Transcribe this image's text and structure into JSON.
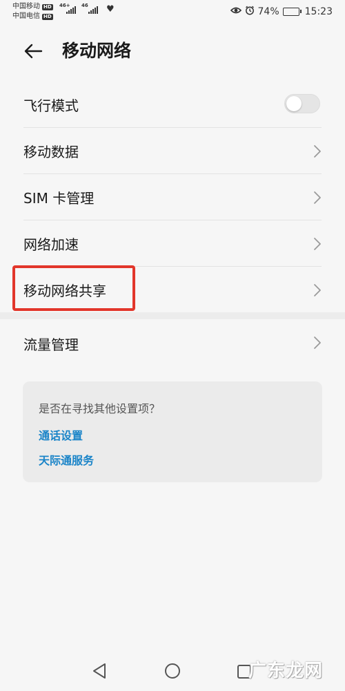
{
  "status_bar": {
    "carrier_1": "中国移动",
    "carrier_2": "中国电信",
    "hd_badge": "HD",
    "net_1": "46+",
    "net_2": "46",
    "battery_percent": "74%",
    "battery_level": 0.74,
    "time": "15:23",
    "icons": [
      "eye-icon",
      "alarm-icon",
      "heart-icon",
      "battery-icon"
    ]
  },
  "header": {
    "title": "移动网络",
    "back_icon": "arrow-left-icon"
  },
  "list": {
    "items": [
      {
        "label": "飞行模式",
        "control": "toggle",
        "on": false
      },
      {
        "label": "移动数据",
        "control": "chevron"
      },
      {
        "label": "SIM 卡管理",
        "control": "chevron"
      },
      {
        "label": "网络加速",
        "control": "chevron"
      },
      {
        "label": "移动网络共享",
        "control": "chevron",
        "highlighted": true
      },
      {
        "label": "流量管理",
        "control": "chevron"
      }
    ]
  },
  "suggestion": {
    "question": "是否在寻找其他设置项？",
    "links": [
      "通话设置",
      "天际通服务"
    ]
  },
  "colors": {
    "accent_link": "#1a84c8",
    "highlight_border": "#e2362b",
    "background": "#f6f6f6",
    "card_background": "#ebebeb"
  },
  "watermark": {
    "text": "广东龙网"
  }
}
